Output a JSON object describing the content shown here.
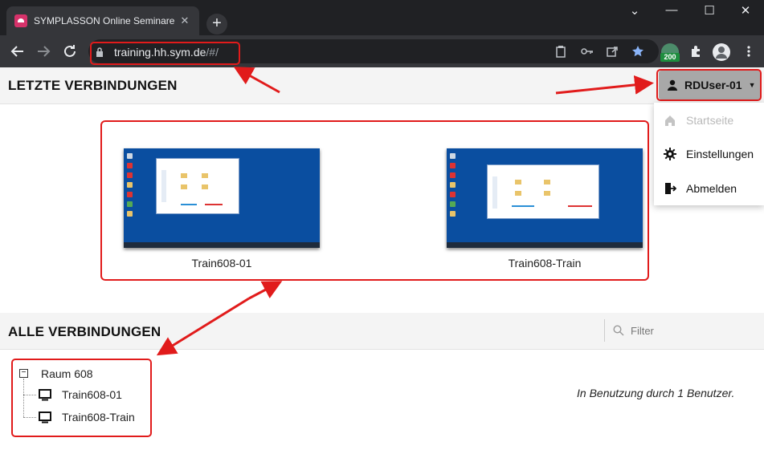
{
  "browser": {
    "tab_title": "SYMPLASSON Online Seminare",
    "tab_close": "✕",
    "new_tab": "+",
    "window_controls": [
      "⌄",
      "—",
      "☐",
      "✕"
    ],
    "url_host": "training.hh.sym.de",
    "url_path": "/#/",
    "extension_badge": "200",
    "nav_icons": [
      "back-icon",
      "forward-icon",
      "reload-icon"
    ],
    "colors": {
      "frame": "#202124",
      "toolbar": "#35363a",
      "accent_red": "#e11b1b",
      "star": "#8ab4f8"
    }
  },
  "header_recent": {
    "title": "LETZTE VERBINDUNGEN"
  },
  "user_menu": {
    "name": "RDUser-01",
    "items": [
      {
        "label": "Startseite",
        "icon": "home-icon",
        "disabled": true
      },
      {
        "label": "Einstellungen",
        "icon": "gear-icon",
        "disabled": false
      },
      {
        "label": "Abmelden",
        "icon": "logout-icon",
        "disabled": false
      }
    ]
  },
  "recent_connections": [
    {
      "label": "Train608-01"
    },
    {
      "label": "Train608-Train"
    }
  ],
  "header_all": {
    "title": "ALLE VERBINDUNGEN",
    "filter_placeholder": "Filter"
  },
  "tree": {
    "group_label": "Raum 608",
    "children": [
      {
        "label": "Train608-01"
      },
      {
        "label": "Train608-Train"
      }
    ]
  },
  "usage_status": "In Benutzung durch 1 Benutzer."
}
